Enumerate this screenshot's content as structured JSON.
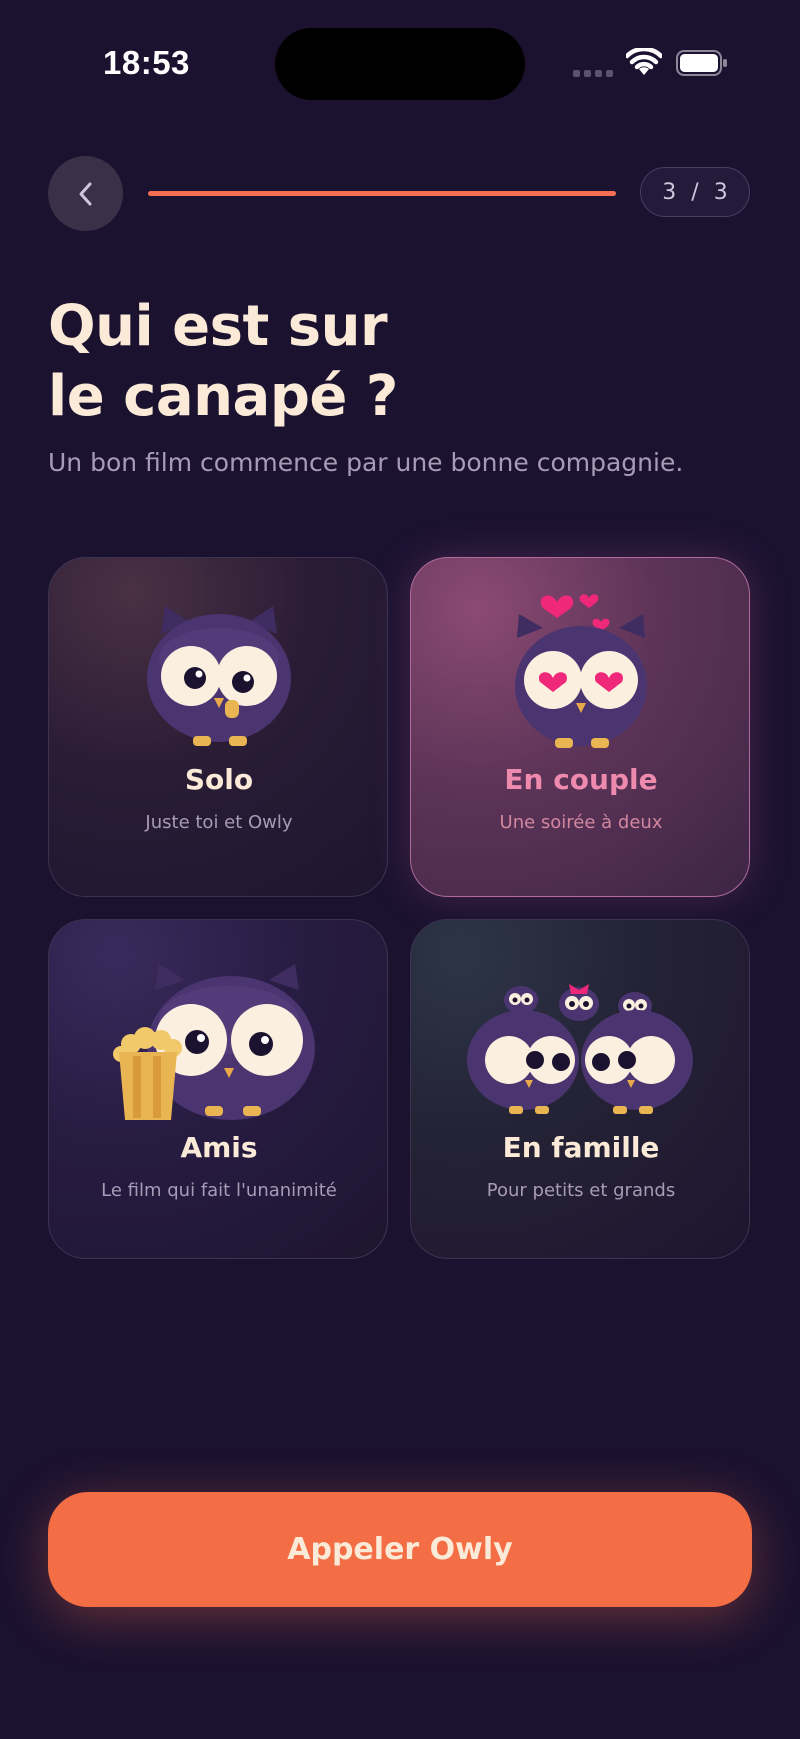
{
  "status_bar": {
    "time": "18:53"
  },
  "header": {
    "step_label": "3 / 3",
    "progress": 1.0
  },
  "page": {
    "title_line1": "Qui est sur",
    "title_line2": "le canapé ?",
    "subtitle": "Un bon film commence par une bonne compagnie."
  },
  "options": [
    {
      "title": "Solo",
      "subtitle": "Juste toi et Owly",
      "selected": false
    },
    {
      "title": "En couple",
      "subtitle": "Une soirée à deux",
      "selected": true
    },
    {
      "title": "Amis",
      "subtitle": "Le film qui fait l'unanimité",
      "selected": false
    },
    {
      "title": "En famille",
      "subtitle": "Pour petits et grands",
      "selected": false
    }
  ],
  "cta": {
    "label": "Appeler Owly"
  },
  "colors": {
    "background": "#1b1230",
    "accent": "#f36e45",
    "selected_text": "#ee8aae",
    "owl_body": "#4b3571",
    "owl_eye": "#fbf0df",
    "heart": "#f0287a",
    "popcorn": "#e9b552"
  },
  "icons": [
    "chevron-left-icon",
    "wifi-icon",
    "battery-icon",
    "signal-icon"
  ]
}
